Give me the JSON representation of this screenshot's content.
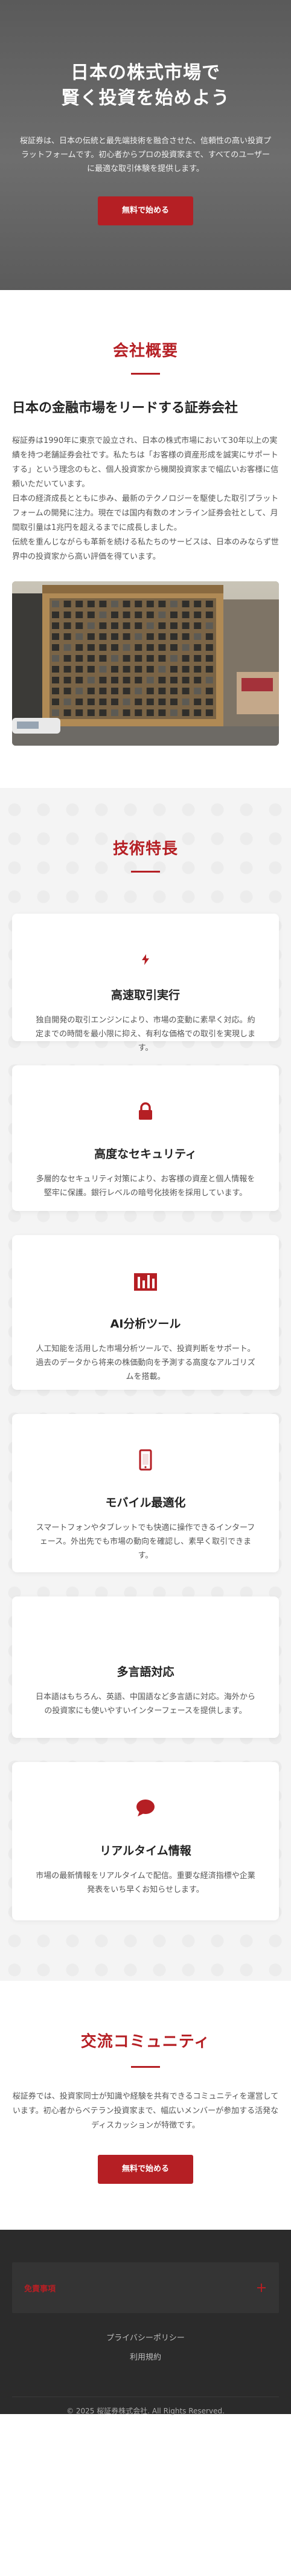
{
  "hero": {
    "title_line1": "日本の株式市場で",
    "title_line2": "賢く投資を始めよう",
    "description": "桜証券は、日本の伝統と最先端技術を融合させた、信頼性の高い投資プラットフォームです。初心者からプロの投資家まで、すべてのユーザーに最適な取引体験を提供します。",
    "cta_label": "無料で始める"
  },
  "about": {
    "section_title": "会社概要",
    "subtitle": "日本の金融市場をリードする証券会社",
    "paragraph1": "桜証券は1990年に東京で設立され、日本の株式市場において30年以上の実績を持つ老舗証券会社です。私たちは「お客様の資産形成を誠実にサポートする」という理念のもと、個人投資家から機関投資家まで幅広いお客様に信頼いただいています。",
    "paragraph2": "日本の経済成長とともに歩み、最新のテクノロジーを駆使した取引プラットフォームの開発に注力。現在では国内有数のオンライン証券会社として、月間取引量は1兆円を超えるまでに成長しました。",
    "paragraph3": "伝統を重んじながらも革新を続ける私たちのサービスは、日本のみならず世界中の投資家から高い評価を得ています。"
  },
  "features": {
    "section_title": "技術特長",
    "items": [
      {
        "icon": "lightning-icon",
        "title": "高速取引実行",
        "text": "独自開発の取引エンジンにより、市場の変動に素早く対応。約定までの時間を最小限に抑え、有利な価格での取引を実現します。"
      },
      {
        "icon": "lock-icon",
        "title": "高度なセキュリティ",
        "text": "多層的なセキュリティ対策により、お客様の資産と個人情報を堅牢に保護。銀行レベルの暗号化技術を採用しています。"
      },
      {
        "icon": "chart-bars-icon",
        "title": "AI分析ツール",
        "text": "人工知能を活用した市場分析ツールで、投資判断をサポート。過去のデータから将来の株価動向を予測する高度なアルゴリズムを搭載。"
      },
      {
        "icon": "mobile-icon",
        "title": "モバイル最適化",
        "text": "スマートフォンやタブレットでも快適に操作できるインターフェース。外出先でも市場の動向を確認し、素早く取引できます。"
      },
      {
        "icon": "globe-icon",
        "title": "多言語対応",
        "text": "日本語はもちろん、英語、中国語など多言語に対応。海外からの投資家にも使いやすいインターフェースを提供します。"
      },
      {
        "icon": "chat-bubble-icon",
        "title": "リアルタイム情報",
        "text": "市場の最新情報をリアルタイムで配信。重要な経済指標や企業発表をいち早くお知らせします。"
      }
    ]
  },
  "community": {
    "section_title": "交流コミュニティ",
    "description": "桜証券では、投資家同士が知識や経験を共有できるコミュニティを運営しています。初心者からベテラン投資家まで、幅広いメンバーが参加する活発なディスカッションが特徴です。",
    "cta_label": "無料で始める"
  },
  "footer": {
    "accordion_label": "免責事項",
    "accordion_icon": "plus-icon",
    "privacy_link": "プライバシーポリシー",
    "terms_link": "利用規約",
    "copyright": "© 2025 桜証券株式会社. All Rights Reserved."
  },
  "colors": {
    "accent": "#b51f24",
    "hero_bg": "#646464",
    "footer_bg": "#2b2b2b"
  }
}
